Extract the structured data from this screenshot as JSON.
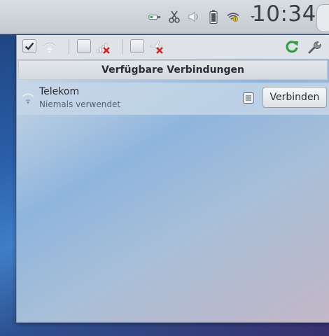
{
  "panel": {
    "clock": "10:34",
    "tray_icons": [
      "network-cable-icon",
      "scissors-icon",
      "speaker-icon",
      "battery-icon",
      "wifi-warning-icon",
      "chevron-down-icon"
    ]
  },
  "popup": {
    "toolbar": {
      "wifi_enabled": true,
      "mobile_enabled": false,
      "airplane_enabled": false,
      "icons": [
        "wifi-icon",
        "mobile-signal-disabled-icon",
        "airplane-disabled-icon",
        "refresh-icon",
        "wrench-icon"
      ]
    },
    "section_title": "Verfügbare Verbindungen",
    "connections": [
      {
        "name": "Telekom",
        "status": "Niemals verwendet",
        "button_label": "Verbinden"
      }
    ]
  },
  "colors": {
    "panel_bg": "#d0d5da",
    "accent_green": "#2ea043",
    "disabled_red": "#d22222"
  }
}
